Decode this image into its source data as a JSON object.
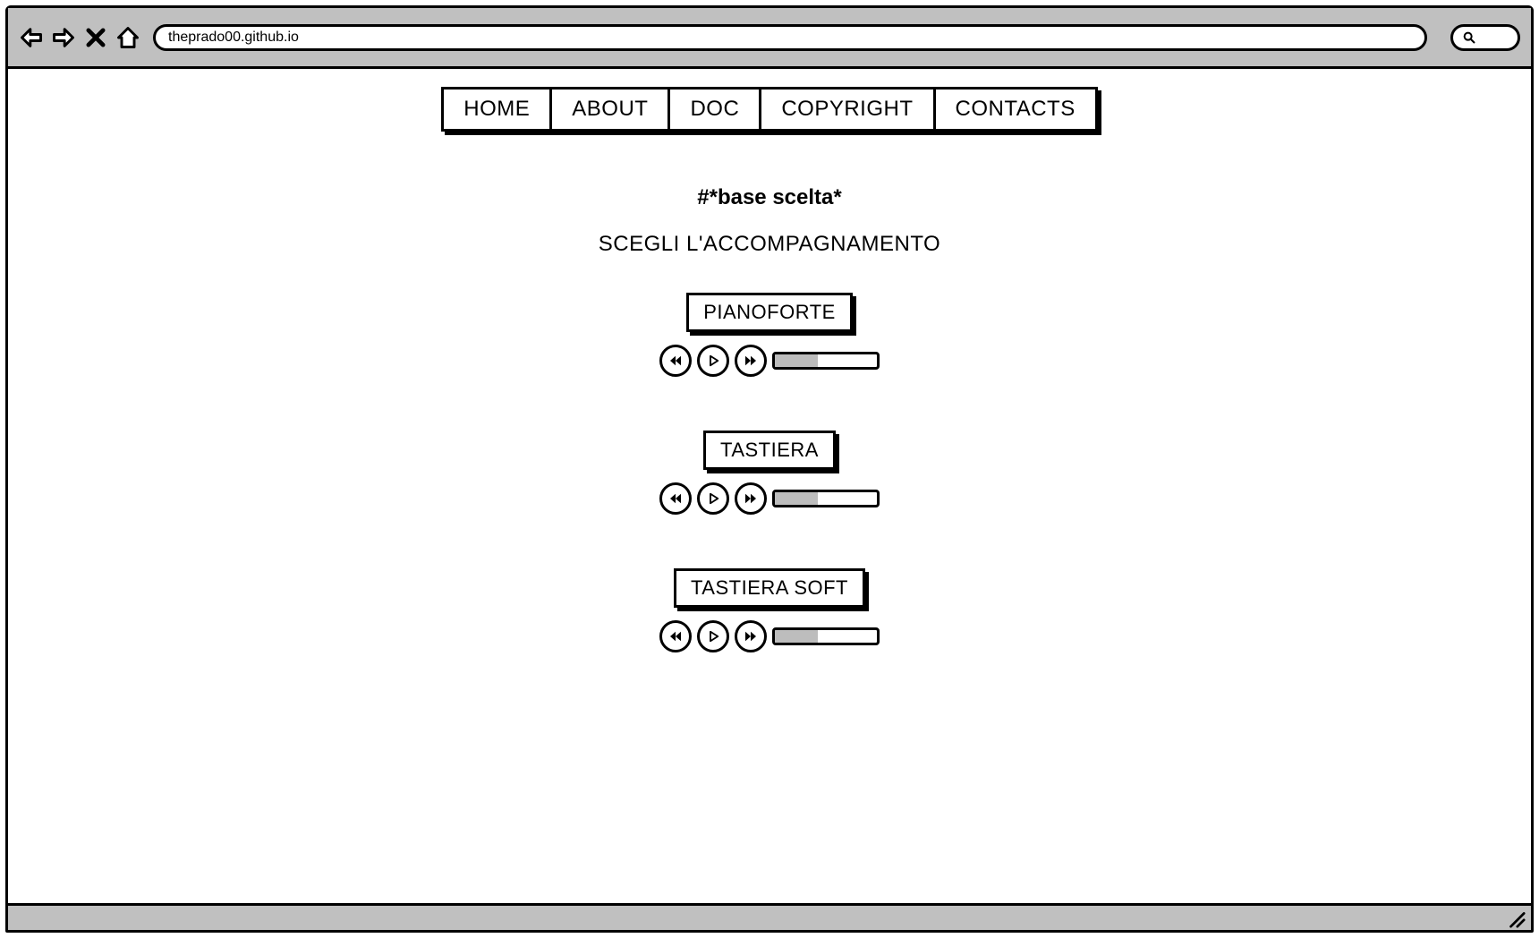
{
  "browser": {
    "url": "theprado00.github.io"
  },
  "nav": {
    "items": [
      "HOME",
      "ABOUT",
      "DOC",
      "COPYRIGHT",
      "CONTACTS"
    ]
  },
  "page": {
    "headline": "#*base scelta*",
    "subhead": "SCEGLI L'ACCOMPAGNAMENTO"
  },
  "tracks": [
    {
      "label": "PIANOFORTE",
      "progress_pct": 42
    },
    {
      "label": "TASTIERA",
      "progress_pct": 42
    },
    {
      "label": "TASTIERA SOFT",
      "progress_pct": 42
    }
  ]
}
